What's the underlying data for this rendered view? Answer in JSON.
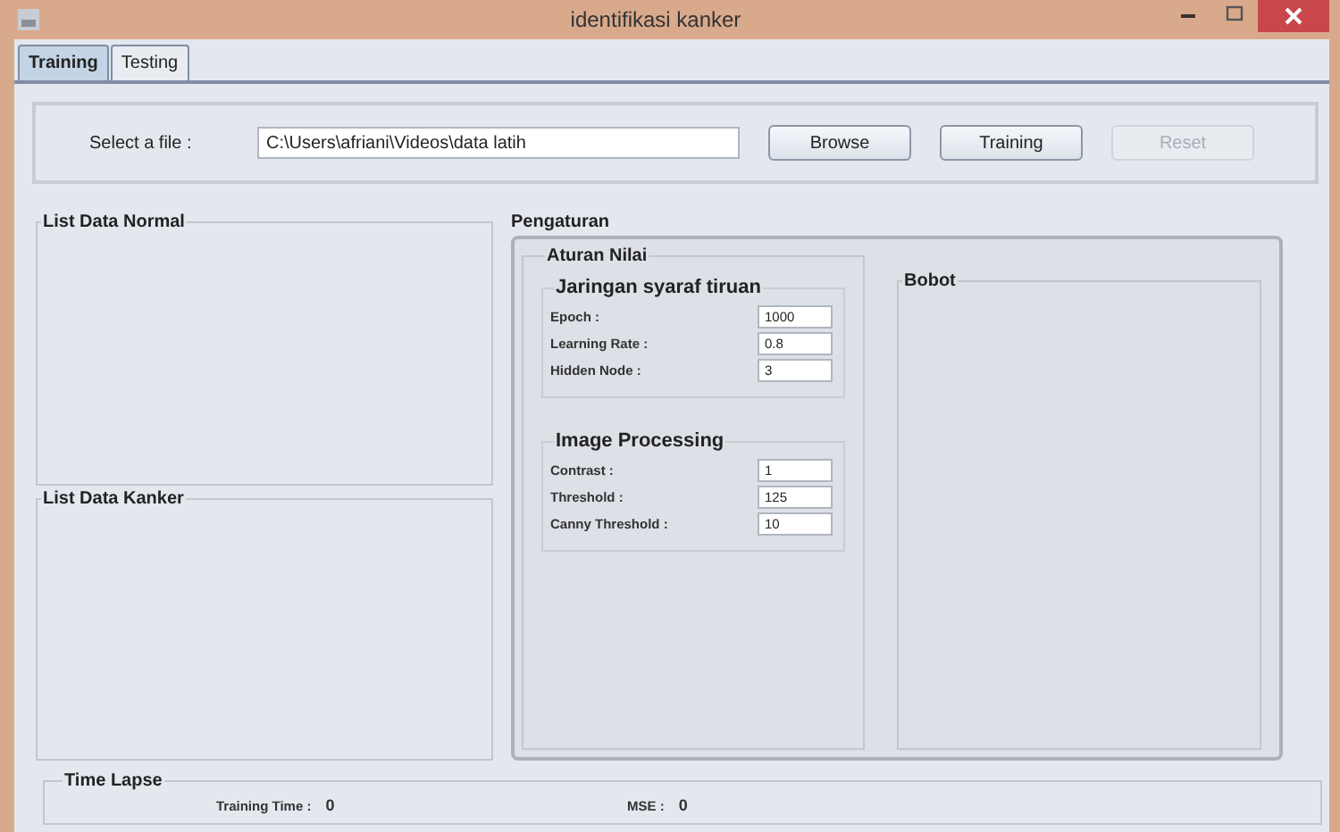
{
  "window": {
    "title": "identifikasi kanker"
  },
  "tabs": [
    {
      "label": "Training",
      "selected": true
    },
    {
      "label": "Testing",
      "selected": false
    }
  ],
  "file_panel": {
    "label": "Select a file :",
    "value": "C:\\Users\\afriani\\Videos\\data latih",
    "buttons": [
      {
        "label": "Browse",
        "disabled": false
      },
      {
        "label": "Training",
        "disabled": false
      },
      {
        "label": "Reset",
        "disabled": true
      }
    ]
  },
  "lists": [
    {
      "title": "List Data Normal"
    },
    {
      "title": "List Data Kanker"
    }
  ],
  "settings": {
    "title": "Pengaturan",
    "rules": {
      "title": "Aturan Nilai",
      "groups": [
        {
          "title": "Jaringan syaraf tiruan",
          "fields": [
            {
              "label": "Epoch :",
              "value": "1000"
            },
            {
              "label": "Learning Rate :",
              "value": "0.8"
            },
            {
              "label": "Hidden Node :",
              "value": "3"
            }
          ]
        },
        {
          "title": "Image Processing",
          "fields": [
            {
              "label": "Contrast :",
              "value": "1"
            },
            {
              "label": "Threshold :",
              "value": "125"
            },
            {
              "label": "Canny Threshold :",
              "value": "10"
            }
          ]
        }
      ]
    },
    "weights": {
      "title": "Bobot"
    }
  },
  "time_lapse": {
    "title": "Time Lapse",
    "items": [
      {
        "label": "Training Time  :",
        "value": "0"
      },
      {
        "label": "MSE :",
        "value": "0"
      }
    ]
  }
}
